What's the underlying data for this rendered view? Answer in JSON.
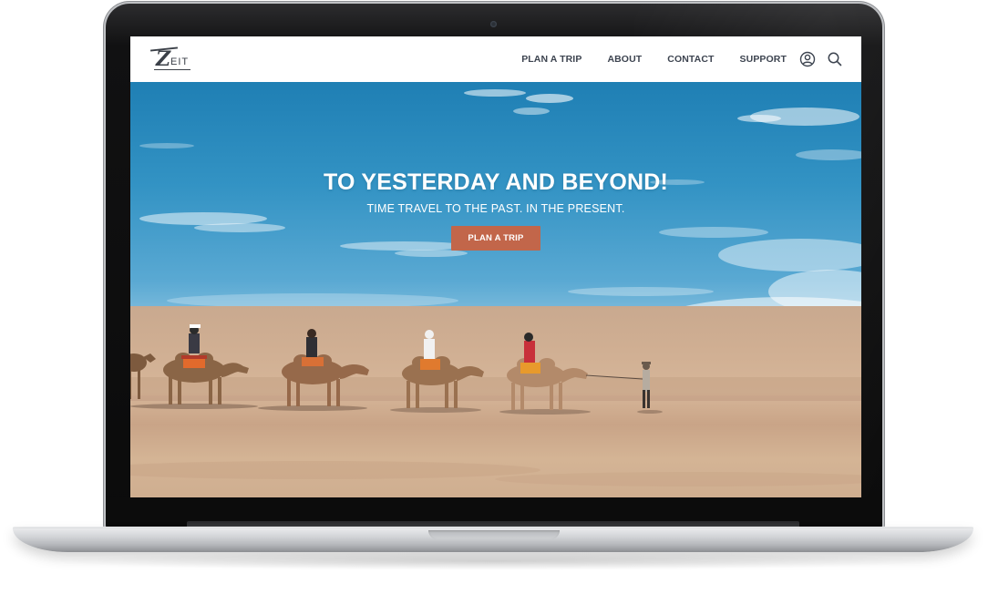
{
  "site": {
    "logo": {
      "mark": "Z",
      "rest": "EIT"
    }
  },
  "navbar": {
    "links": [
      {
        "label": "PLAN A TRIP"
      },
      {
        "label": "ABOUT"
      },
      {
        "label": "CONTACT"
      },
      {
        "label": "SUPPORT"
      }
    ],
    "icons": [
      "user-icon",
      "search-icon"
    ]
  },
  "hero": {
    "title": "TO YESTERDAY AND BEYOND!",
    "subtitle": "TIME TRAVEL TO THE PAST. IN THE PRESENT.",
    "button_label": "PLAN A TRIP",
    "background": "desert-camel-caravan-photo"
  },
  "colors": {
    "accent": "#c2664a",
    "nav_text": "#3d4450",
    "sky": "#2f8fc2",
    "sand": "#d3b293"
  },
  "device": "laptop-mockup"
}
